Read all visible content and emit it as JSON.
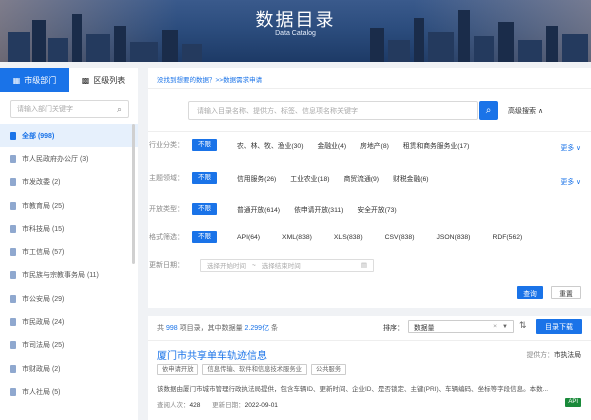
{
  "banner": {
    "title": "数据目录",
    "subtitle": "Data Catalog"
  },
  "sidebar": {
    "tabs": [
      {
        "label": "市级部门",
        "icon": "building-icon"
      },
      {
        "label": "区级列表",
        "icon": "grid-icon"
      }
    ],
    "search_placeholder": "请输入部门关键字",
    "items": [
      {
        "label": "全部 (998)"
      },
      {
        "label": "市人民政府办公厅 (3)"
      },
      {
        "label": "市发改委 (2)"
      },
      {
        "label": "市教育局 (25)"
      },
      {
        "label": "市科技局 (15)"
      },
      {
        "label": "市工信局 (57)"
      },
      {
        "label": "市民族与宗教事务局 (11)"
      },
      {
        "label": "市公安局 (29)"
      },
      {
        "label": "市民政局 (24)"
      },
      {
        "label": "市司法局 (25)"
      },
      {
        "label": "市财政局 (2)"
      },
      {
        "label": "市人社局 (5)"
      }
    ]
  },
  "main": {
    "topline": "没找到想要的数据？>>数据需求申请",
    "search_placeholder": "请输入目录名称、提供方、标签、信息项名称关键字",
    "advanced": "高级搜索 ∧",
    "filters": [
      {
        "label": "行业分类：",
        "chip": "不限",
        "options": [
          "农、林、牧、渔业(30)",
          "金融业(4)",
          "房地产(8)",
          "租赁和商务服务业(17)"
        ],
        "more": "更多 ∨"
      },
      {
        "label": "主题领域：",
        "chip": "不限",
        "options": [
          "信用服务(26)",
          "工业农业(18)",
          "商贸流通(9)",
          "财税金融(6)"
        ],
        "more": "更多 ∨"
      },
      {
        "label": "开放类型：",
        "chip": "不限",
        "options": [
          "普通开放(614)",
          "依申请开放(311)",
          "安全开放(73)"
        ],
        "more": ""
      },
      {
        "label": "格式筛选：",
        "chip": "不限",
        "options": [
          "API(64)",
          "XML(838)",
          "XLS(838)",
          "CSV(838)",
          "JSON(838)",
          "RDF(562)"
        ],
        "more": ""
      }
    ],
    "date": {
      "label": "更新日期：",
      "start": "选择开始时间",
      "sep": "~",
      "end": "选择结束时间"
    },
    "query_button": "查询",
    "reset_button": "重置"
  },
  "results": {
    "summary_prefix": "共",
    "total": "998",
    "summary_mid": "项目录，其中数据量",
    "volume": "2.299亿",
    "summary_suffix": "条",
    "sort_label": "排序：",
    "sort_value": "数据量",
    "download_button": "目录下载",
    "item": {
      "title": "厦门市共享单车轨迹信息",
      "provider_label": "提供方：",
      "provider": "市执法局",
      "tags": [
        "依申请开放",
        "信息传输、软件和信息技术服务业",
        "公共服务"
      ],
      "description": "该数据由厦门市城市管理行政执法局提供，包含车辆ID、更新时间、企业ID、是否锁定、主键(PRI)、车辆编码、坐标等字段信息。本数...",
      "views_label": "查阅人次：",
      "views": "428",
      "updated_label": "更新日期：",
      "updated": "2022-09-01",
      "format_badge": "API"
    }
  },
  "colors": {
    "accent": "#1a73e8",
    "api_badge": "#1a8a3a"
  }
}
